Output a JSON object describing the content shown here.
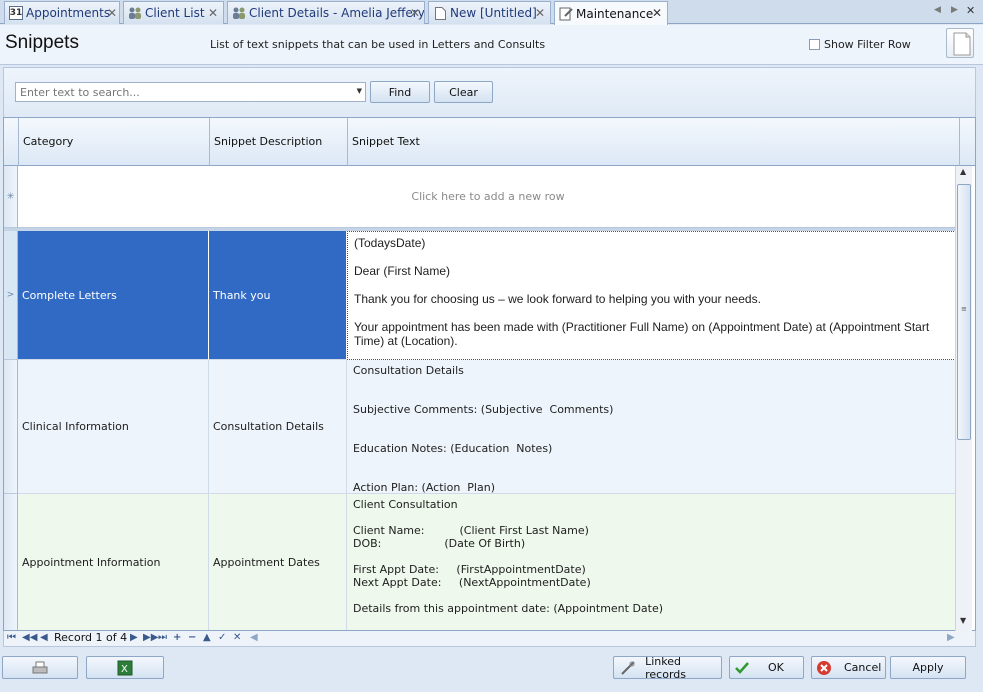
{
  "tabs": [
    {
      "label": "Appointments",
      "icon": "calendar-icon",
      "icon_text": "31"
    },
    {
      "label": "Client List",
      "icon": "people-icon"
    },
    {
      "label": "Client Details - Amelia Jefferys",
      "icon": "people-icon"
    },
    {
      "label": "New [Untitled]",
      "icon": "document-icon"
    },
    {
      "label": "Maintenance",
      "icon": "maintenance-icon"
    }
  ],
  "header": {
    "title": "Snippets",
    "subtitle": "List of text snippets that can be used in Letters and Consults",
    "filter_label": "Show Filter Row",
    "filter_checked": false
  },
  "search": {
    "placeholder": "Enter text to search...",
    "find_label": "Find",
    "clear_label": "Clear"
  },
  "grid": {
    "columns": [
      "Category",
      "Snippet Description",
      "Snippet Text"
    ],
    "new_row_text": "Click here to add a new row",
    "rows": [
      {
        "category": "Complete Letters",
        "description": "Thank you",
        "text": "(TodaysDate)\n\nDear (First Name)\n\nThank you for choosing us – we look forward to helping you with your needs.\n\nYour appointment has been made with (Practitioner Full Name) on (Appointment Date) at (Appointment Start Time) at (Location).",
        "selected": true
      },
      {
        "category": "Clinical Information",
        "description": "Consultation Details",
        "text": "Consultation Details\n\n\nSubjective Comments: (Subjective  Comments)\n\n\nEducation Notes: (Education  Notes)\n\n\nAction Plan: (Action  Plan)",
        "selected": false
      },
      {
        "category": "Appointment Information",
        "description": "Appointment Dates",
        "text": "Client Consultation\n\nClient Name:          (Client First Last Name)\nDOB:                  (Date Of Birth)\n\nFirst Appt Date:     (FirstAppointmentDate)\nNext Appt Date:     (NextAppointmentDate)\n\nDetails from this appointment date: (Appointment Date)",
        "selected": false
      }
    ]
  },
  "navigator": {
    "record_text": "Record 1 of 4"
  },
  "footer": {
    "linked_label": "Linked records",
    "ok_label": "OK",
    "cancel_label": "Cancel",
    "apply_label": "Apply"
  },
  "colors": {
    "selection": "#316ac5",
    "row_alt_blue": "#eef4fb",
    "row_alt_green": "#eef8ec",
    "accent_border": "#8ea6c6"
  }
}
